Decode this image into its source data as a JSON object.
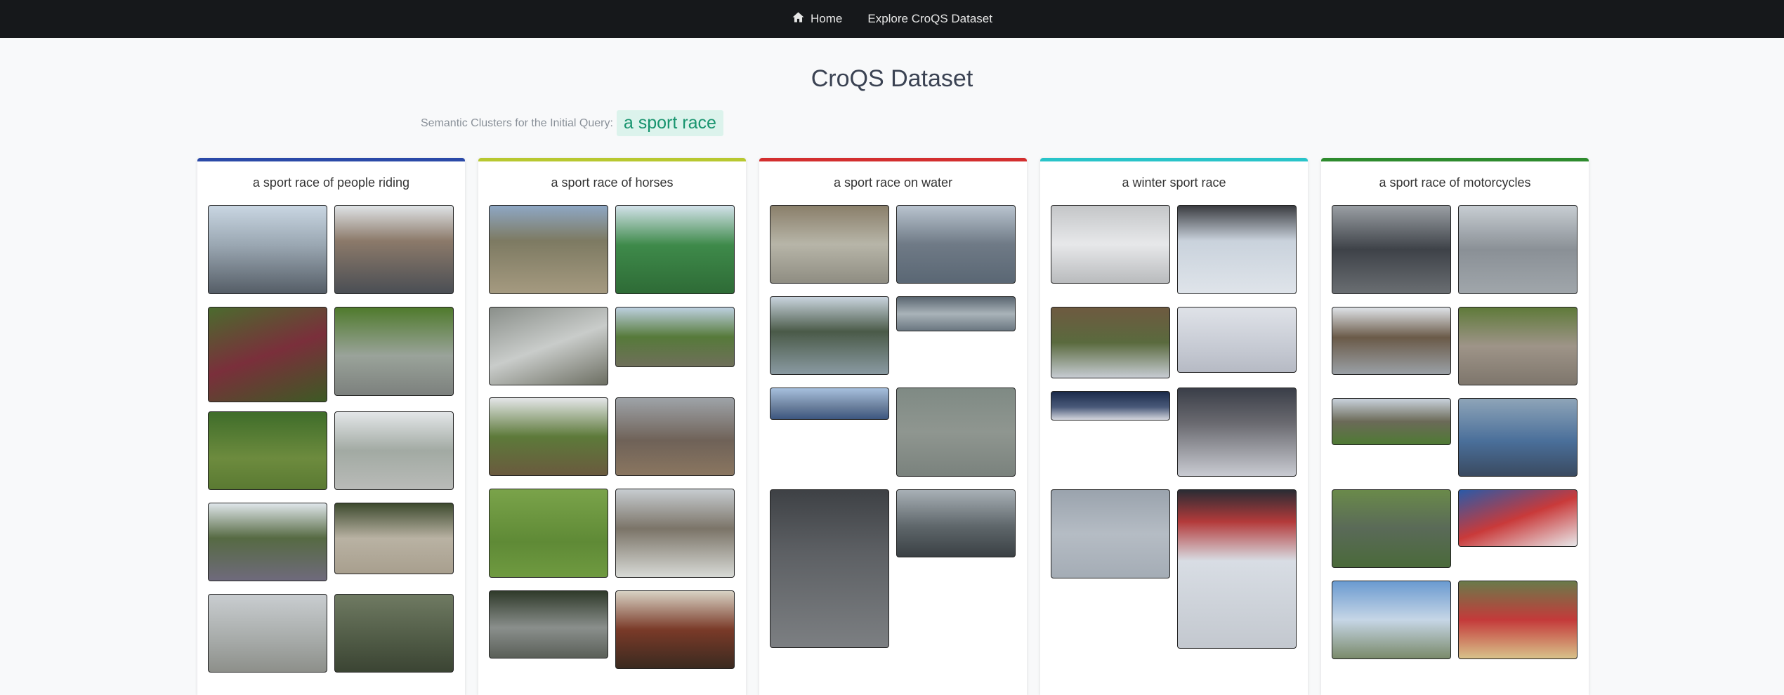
{
  "nav": {
    "home_label": "Home",
    "explore_label": "Explore CroQS Dataset",
    "home_icon": "home-icon"
  },
  "page": {
    "title": "CroQS Dataset"
  },
  "query": {
    "label": "Semantic Clusters for the Initial Query:",
    "value": "a sport race"
  },
  "clusters": [
    {
      "title": "a sport race of people riding",
      "accent": "#2b4aa8"
    },
    {
      "title": "a sport race of horses",
      "accent": "#b8c830"
    },
    {
      "title": "a sport race on water",
      "accent": "#d32f2f"
    },
    {
      "title": "a winter sport race",
      "accent": "#29c4c9"
    },
    {
      "title": "a sport race of motorcycles",
      "accent": "#2e8b2e"
    }
  ]
}
